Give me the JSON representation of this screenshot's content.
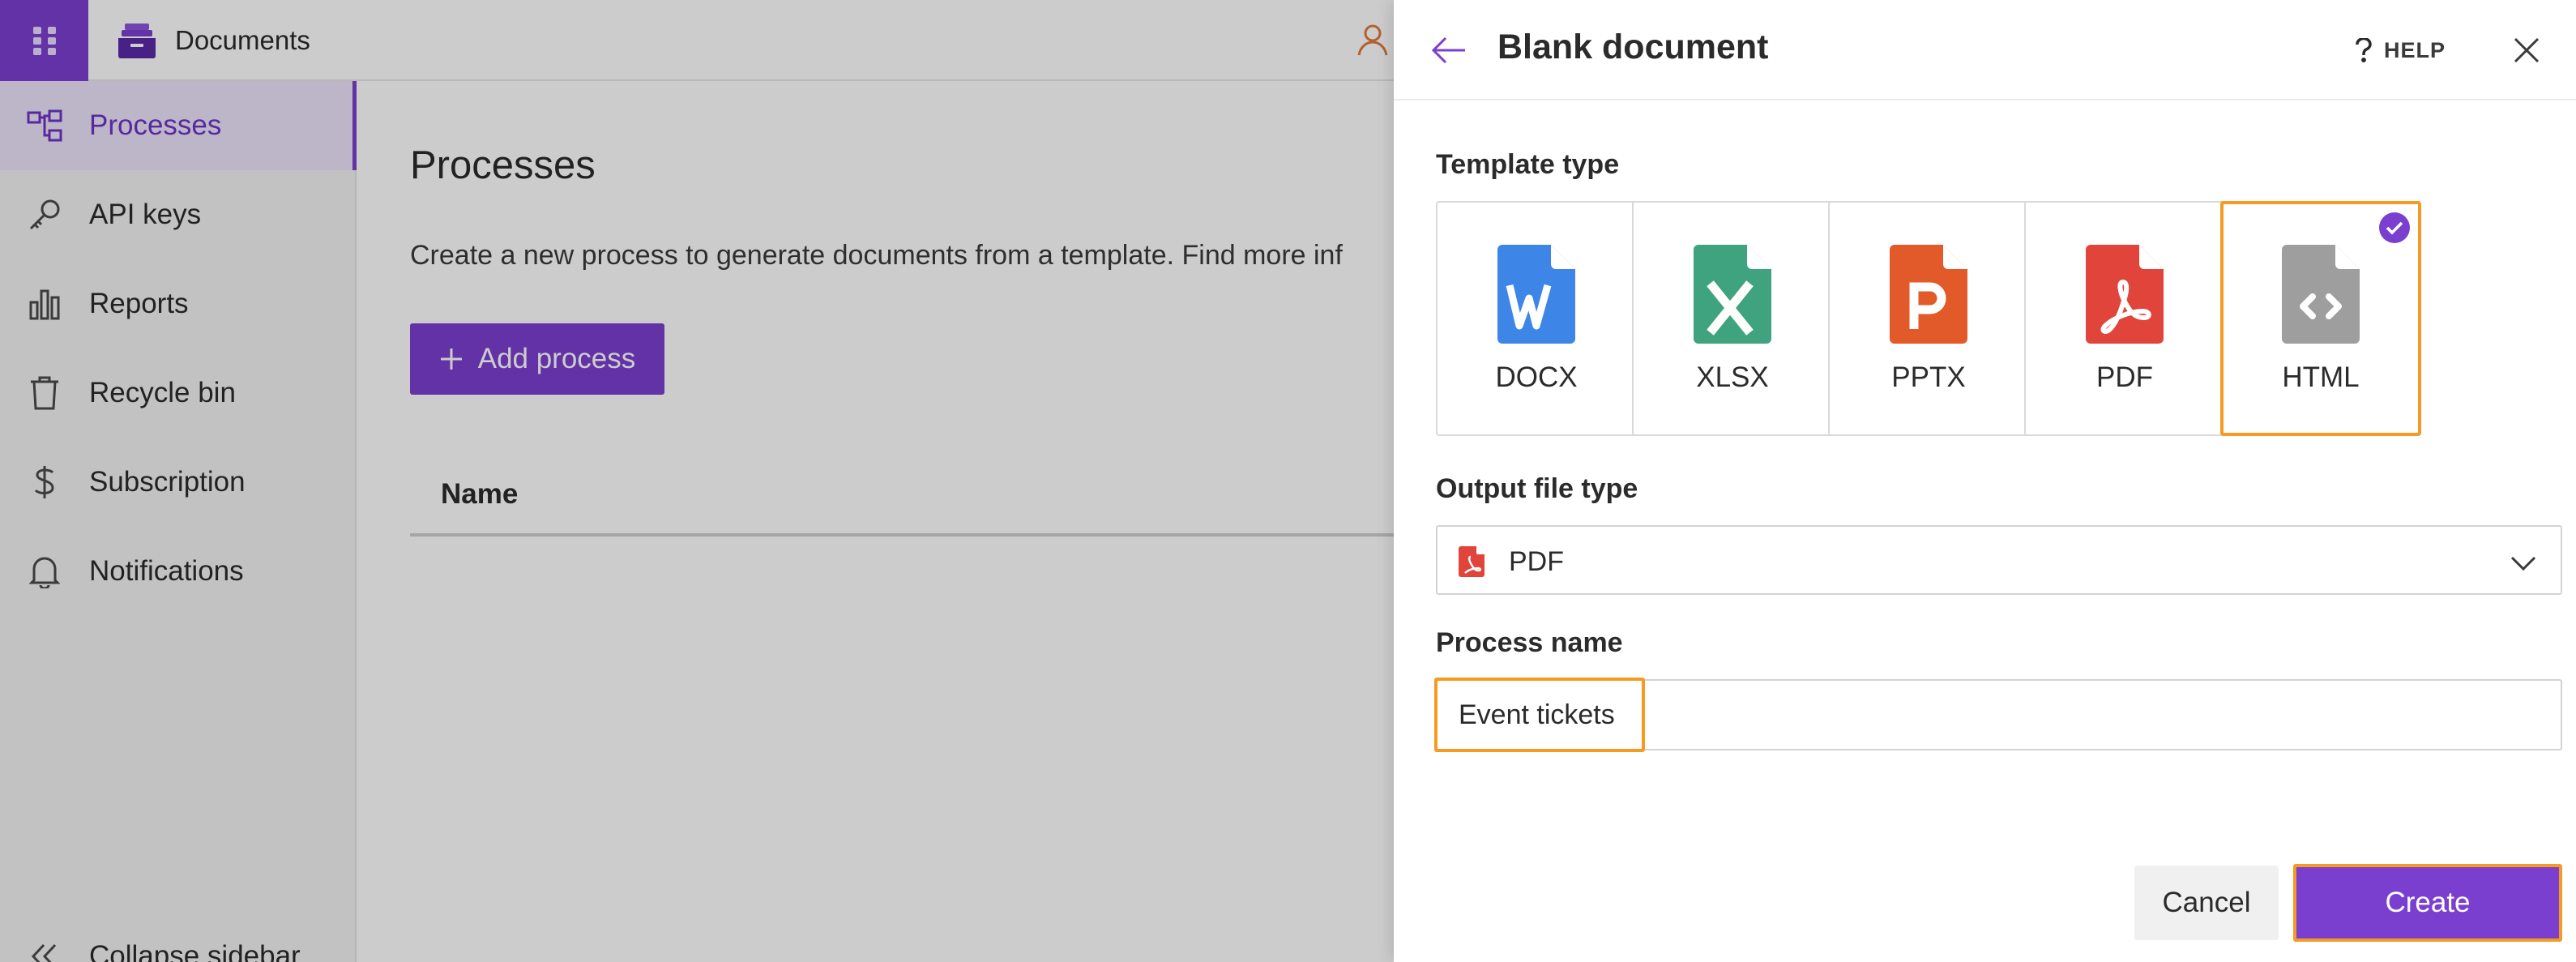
{
  "app": {
    "name": "Documents",
    "colors": {
      "brand": "#7b3fd0",
      "highlight": "#f59a23"
    }
  },
  "sidebar": {
    "items": [
      {
        "label": "Processes",
        "icon": "process-flow-icon",
        "active": true
      },
      {
        "label": "API keys",
        "icon": "key-icon",
        "active": false
      },
      {
        "label": "Reports",
        "icon": "bar-chart-icon",
        "active": false
      },
      {
        "label": "Recycle bin",
        "icon": "trash-icon",
        "active": false
      },
      {
        "label": "Subscription",
        "icon": "dollar-icon",
        "active": false
      },
      {
        "label": "Notifications",
        "icon": "bell-icon",
        "active": false
      }
    ],
    "collapse_label": "Collapse sidebar"
  },
  "main": {
    "title": "Processes",
    "description": "Create a new process to generate documents from a template. Find more inf",
    "add_button_label": "Add process",
    "table": {
      "columns": [
        "Name"
      ]
    }
  },
  "panel": {
    "title": "Blank document",
    "help_label": "HELP",
    "template_type_label": "Template type",
    "templates": [
      {
        "label": "DOCX",
        "color": "#3d86e8",
        "letter": "W",
        "selected": false
      },
      {
        "label": "XLSX",
        "color": "#3ea37e",
        "letter": "X",
        "selected": false
      },
      {
        "label": "PPTX",
        "color": "#e25a2a",
        "letter": "P",
        "selected": false
      },
      {
        "label": "PDF",
        "color": "#e0443a",
        "letter": "",
        "selected": false
      },
      {
        "label": "HTML",
        "color": "#9e9e9e",
        "letter": "",
        "selected": true
      }
    ],
    "output_type_label": "Output file type",
    "output_type_value": "PDF",
    "process_name_label": "Process name",
    "process_name_value": "Event tickets",
    "cancel_label": "Cancel",
    "create_label": "Create"
  }
}
